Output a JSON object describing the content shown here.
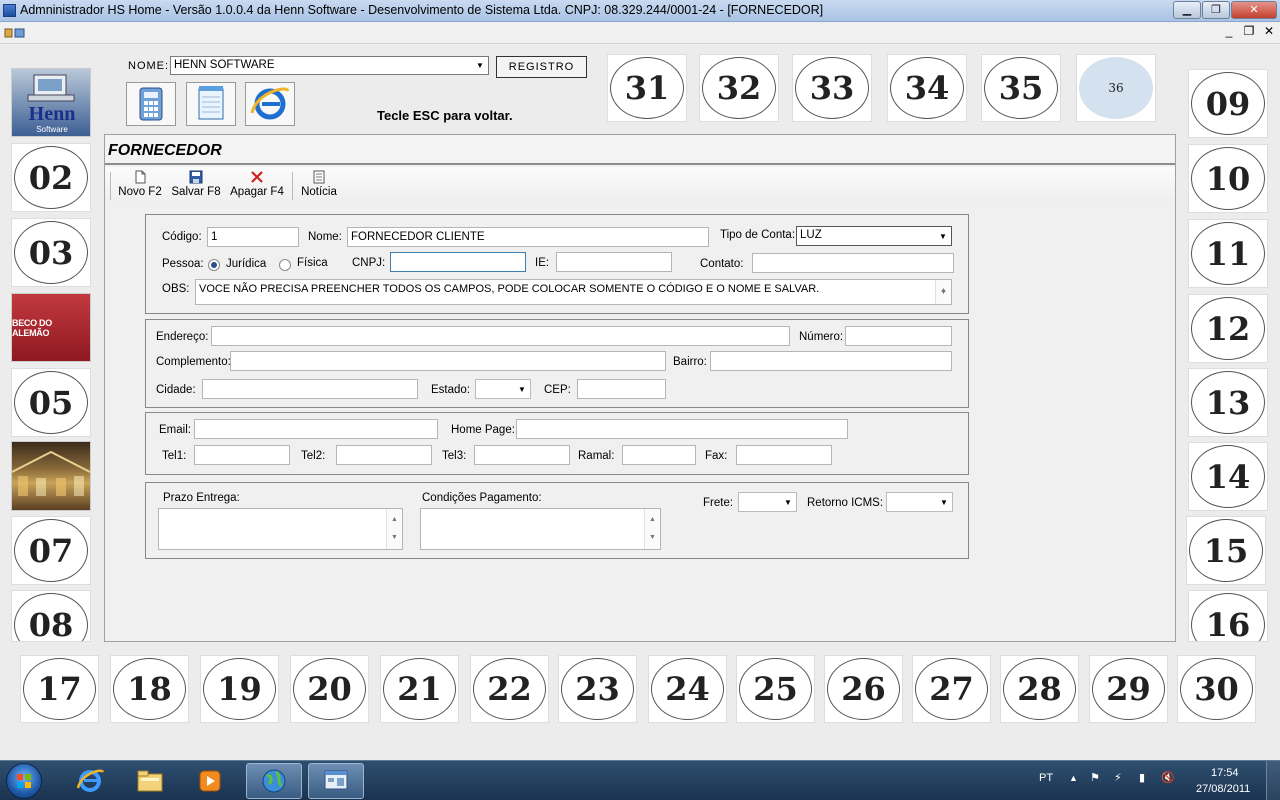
{
  "window": {
    "title": "Admninistrador HS Home - Versão 1.0.0.4 da Henn Software - Desenvolvimento de Sistema Ltda. CNPJ: 08.329.244/0001-24 - [FORNECEDOR]",
    "minimize": "▁",
    "maximize": "❐",
    "close": "✕"
  },
  "mdi": {
    "minimize": "_",
    "restore": "❐",
    "close": "✕"
  },
  "header": {
    "nome_label": "NOME:",
    "nome_value": "HENN SOFTWARE",
    "registro_label": "REGISTRO",
    "esc_hint": "Tecle ESC para voltar.",
    "logo_line1": "Henn",
    "logo_line2": "Software",
    "beco_label": "BECO DO ALEMÃO"
  },
  "top_numbers": [
    "31",
    "32",
    "33",
    "34",
    "35"
  ],
  "top_selected": "36",
  "left_numbers": [
    "02",
    "03",
    "05",
    "07",
    "08"
  ],
  "right_numbers": [
    "09",
    "10",
    "11",
    "12",
    "13",
    "14",
    "15",
    "16"
  ],
  "bottom_numbers": [
    "17",
    "18",
    "19",
    "20",
    "21",
    "22",
    "23",
    "24",
    "25",
    "26",
    "27",
    "28",
    "29",
    "30"
  ],
  "form": {
    "title": "FORNECEDOR",
    "toolbar": {
      "novo": "Novo F2",
      "salvar": "Salvar F8",
      "apagar": "Apagar F4",
      "noticia": "Notícia"
    },
    "codigo_label": "Código:",
    "codigo_value": "1",
    "nome_label": "Nome:",
    "nome_value": "FORNECEDOR CLIENTE",
    "tipo_conta_label": "Tipo de Conta:",
    "tipo_conta_value": "LUZ",
    "pessoa_label": "Pessoa:",
    "juridica_label": "Jurídica",
    "fisica_label": "Física",
    "cnpj_label": "CNPJ:",
    "ie_label": "IE:",
    "contato_label": "Contato:",
    "obs_label": "OBS:",
    "obs_value": "VOCE NÃO PRECISA PREENCHER TODOS OS CAMPOS, PODE COLOCAR SOMENTE O CÓDIGO E O NOME E SALVAR.",
    "endereco_label": "Endereço:",
    "numero_label": "Número:",
    "complemento_label": "Complemento:",
    "bairro_label": "Bairro:",
    "cidade_label": "Cidade:",
    "estado_label": "Estado:",
    "cep_label": "CEP:",
    "email_label": "Email:",
    "homepage_label": "Home Page:",
    "tel1_label": "Tel1:",
    "tel2_label": "Tel2:",
    "tel3_label": "Tel3:",
    "ramal_label": "Ramal:",
    "fax_label": "Fax:",
    "prazo_label": "Prazo Entrega:",
    "condicoes_label": "Condições Pagamento:",
    "frete_label": "Frete:",
    "retorno_label": "Retorno ICMS:"
  },
  "taskbar": {
    "lang": "PT",
    "time": "17:54",
    "date": "27/08/2011"
  },
  "colors": {
    "accent": "#2b4f86",
    "taskbar": "#1a3350",
    "beco": "#b0232b"
  }
}
